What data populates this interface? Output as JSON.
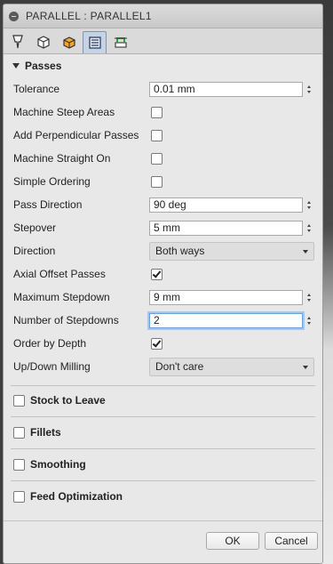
{
  "dialog": {
    "title": "PARALLEL : PARALLEL1"
  },
  "tabs": [
    {
      "icon": "tool-icon",
      "active": false
    },
    {
      "icon": "geometry-icon",
      "active": false
    },
    {
      "icon": "heights-icon",
      "active": false
    },
    {
      "icon": "passes-icon",
      "active": true
    },
    {
      "icon": "linking-icon",
      "active": false
    }
  ],
  "passes": {
    "header": "Passes",
    "tolerance": {
      "label": "Tolerance",
      "value": "0.01 mm"
    },
    "machine_steep_areas": {
      "label": "Machine Steep Areas",
      "checked": false
    },
    "add_perpendicular_passes": {
      "label": "Add Perpendicular Passes",
      "checked": false
    },
    "machine_straight_on": {
      "label": "Machine Straight On",
      "checked": false
    },
    "simple_ordering": {
      "label": "Simple Ordering",
      "checked": false
    },
    "pass_direction": {
      "label": "Pass Direction",
      "value": "90 deg"
    },
    "stepover": {
      "label": "Stepover",
      "value": "5 mm"
    },
    "direction": {
      "label": "Direction",
      "value": "Both ways"
    },
    "axial_offset_passes": {
      "label": "Axial Offset Passes",
      "checked": true
    },
    "maximum_stepdown": {
      "label": "Maximum Stepdown",
      "value": "9 mm"
    },
    "number_of_stepdowns": {
      "label": "Number of Stepdowns",
      "value": "2"
    },
    "order_by_depth": {
      "label": "Order by Depth",
      "checked": true
    },
    "up_down_milling": {
      "label": "Up/Down Milling",
      "value": "Don't care"
    }
  },
  "groups": {
    "stock_to_leave": {
      "label": "Stock to Leave",
      "checked": false
    },
    "fillets": {
      "label": "Fillets",
      "checked": false
    },
    "smoothing": {
      "label": "Smoothing",
      "checked": false
    },
    "feed_optimization": {
      "label": "Feed Optimization",
      "checked": false
    }
  },
  "footer": {
    "ok_label": "OK",
    "cancel_label": "Cancel"
  }
}
